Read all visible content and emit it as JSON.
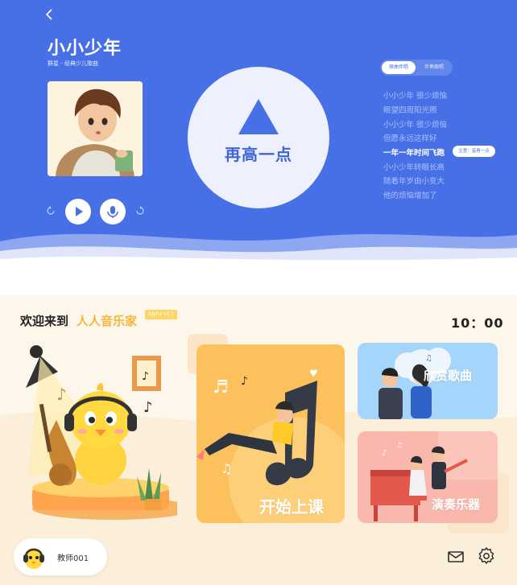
{
  "player": {
    "back_icon": "chevron-left-icon",
    "song_title": "小小少年",
    "song_subtitle": "群星 - 经典少儿歌曲",
    "feedback_text": "再高一点",
    "mode_toggle": {
      "active": "原曲伴唱",
      "inactive": "伴奏跟唱"
    },
    "lyrics": [
      "小小少年 很少烦恼",
      "眼望四周阳光照",
      "小小少年 很少烦恼",
      "但愿永远这样好",
      "一年一年时间飞跑",
      "小小少年转眼长高",
      "随着年岁由小变大",
      "他的烦恼增加了"
    ],
    "active_lyric_index": 4,
    "lyric_hint": "注意：音再一点",
    "controls": [
      "rewind-icon",
      "play-icon",
      "microphone-icon",
      "forward-icon"
    ],
    "colors": {
      "primary": "#4870e6",
      "circle": "#eef1fd"
    }
  },
  "home": {
    "welcome": "欢迎来到",
    "brand": "人人音乐家",
    "version": "Alpha v0.1",
    "clock": "10：00",
    "cards": {
      "start_class": "开始上课",
      "appreciate": "欣赏歌曲",
      "perform": "演奏乐器"
    },
    "user": {
      "name": "教师001"
    },
    "icons": [
      "mail-icon",
      "settings-icon"
    ],
    "colors": {
      "brand": "#f5b63a",
      "start": "#fcc15d",
      "listen": "#a6d5fb",
      "perform": "#f9b7ad"
    }
  }
}
